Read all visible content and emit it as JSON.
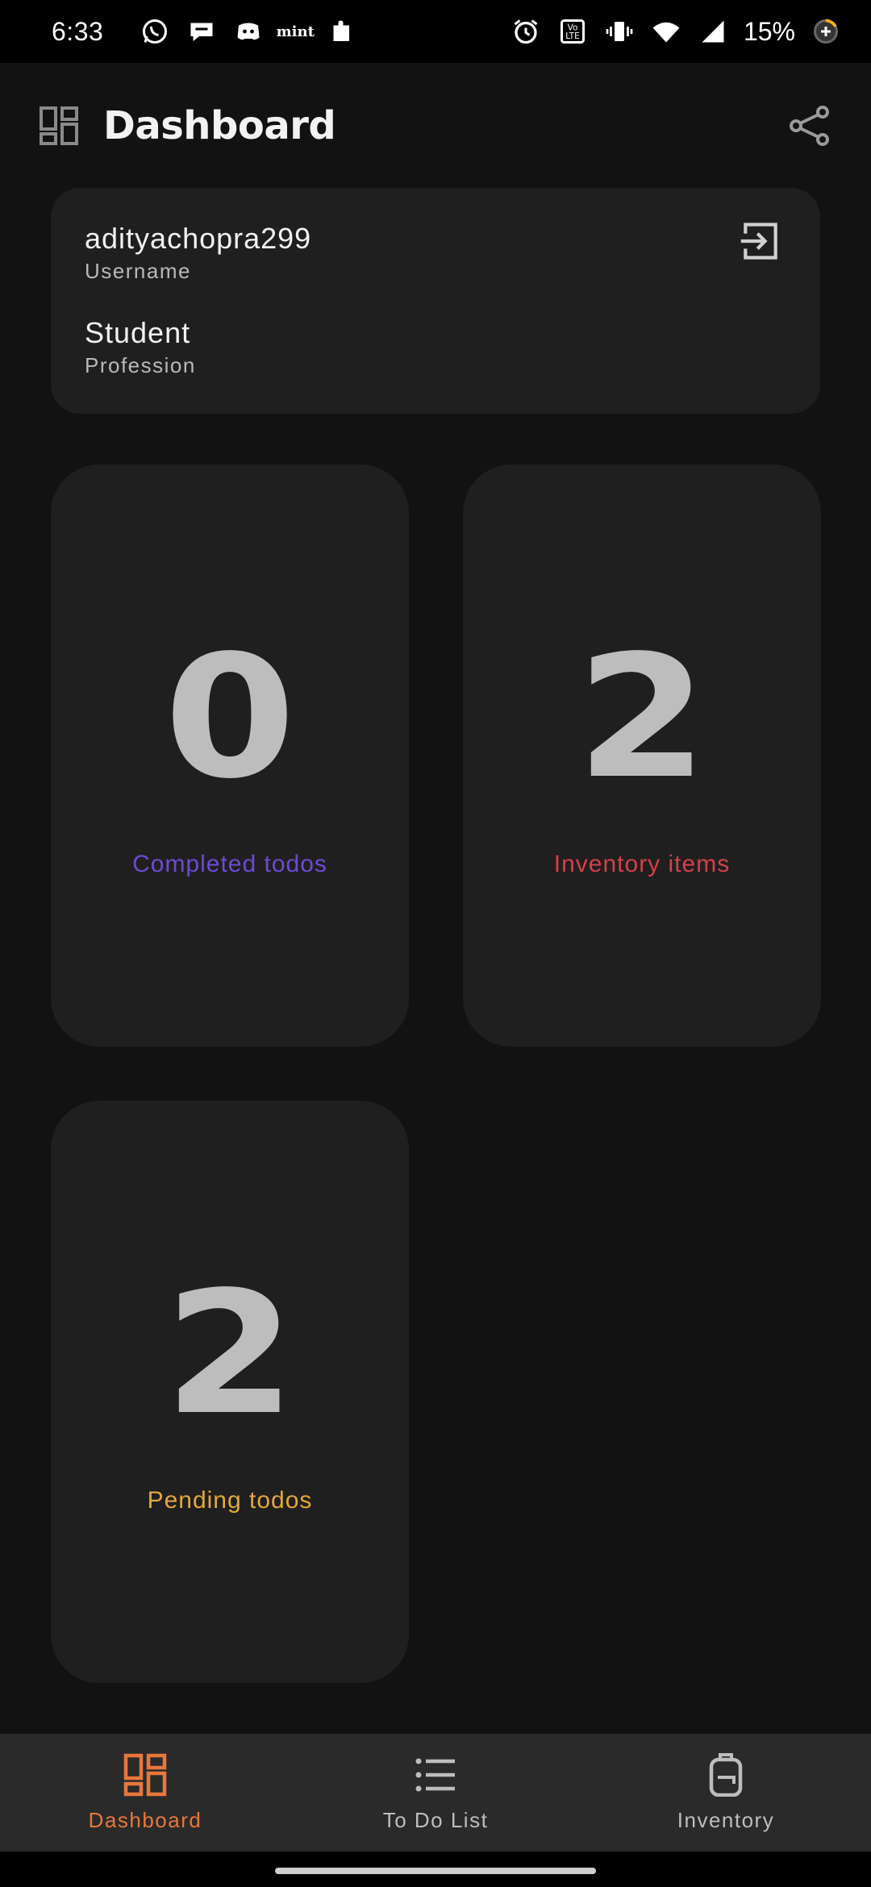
{
  "status_bar": {
    "time": "6:33",
    "left_icons": [
      "whatsapp-icon",
      "message-icon",
      "discord-icon",
      "mint-icon",
      "puzzle-icon"
    ],
    "mint_label": "mint",
    "right_icons": [
      "alarm-icon",
      "volte-icon",
      "vibrate-icon",
      "wifi-icon",
      "signal-icon",
      "battery-icon"
    ],
    "battery": "15%"
  },
  "app_bar": {
    "title": "Dashboard",
    "icon": "dashboard-icon",
    "action_icon": "share-icon"
  },
  "profile": {
    "username_value": "adityachopra299",
    "username_label": "Username",
    "profession_value": "Student",
    "profession_label": "Profession",
    "action_icon": "logout-icon"
  },
  "stats": [
    {
      "value": "0",
      "label": "Completed todos",
      "color": "#6c4bd4"
    },
    {
      "value": "2",
      "label": "Inventory items",
      "color": "#d3404a"
    },
    {
      "value": "2",
      "label": "Pending todos",
      "color": "#e3a83a"
    }
  ],
  "bottom_nav": {
    "items": [
      {
        "label": "Dashboard",
        "icon": "dashboard-icon",
        "active": true
      },
      {
        "label": "To Do List",
        "icon": "list-icon",
        "active": false
      },
      {
        "label": "Inventory",
        "icon": "backpack-icon",
        "active": false
      }
    ]
  },
  "colors": {
    "background": "#121212",
    "card": "#1f1f1f",
    "nav_background": "#2a2a2a",
    "accent": "#e9773a"
  }
}
